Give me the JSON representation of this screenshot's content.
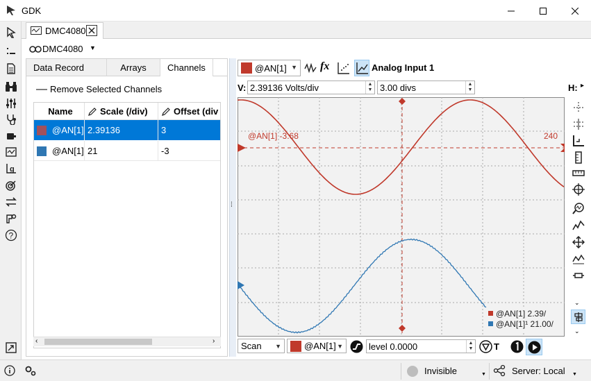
{
  "app": {
    "title": "GDK",
    "doc_tab": "DMC4080",
    "controller": "DMC4080"
  },
  "left_panel": {
    "tabs": [
      "Data Record",
      "Arrays",
      "Channels"
    ],
    "active_tab": "Channels",
    "remove_label": "Remove Selected Channels",
    "table": {
      "headers": [
        "Name",
        "Scale (/div)",
        "Offset (div"
      ],
      "rows": [
        {
          "name": "@AN[1]",
          "scale": "2.39136",
          "offset": "3",
          "color": "#a0515c",
          "selected": true
        },
        {
          "name": "@AN[1]",
          "scale": "21",
          "offset": "-3",
          "color": "#2f77b3",
          "selected": false
        }
      ]
    }
  },
  "scope": {
    "channel_select": "@AN[1]",
    "channel_title": "Analog Input 1",
    "v_label": "V:",
    "v_scale": "2.39136 Volts/div",
    "v_divs": "3.00 divs",
    "h_label": "H:",
    "marker_label": "@AN[1] -3.68",
    "marker_value": "240",
    "legend": [
      {
        "text": "@AN[1] 2.39/",
        "color": "#c0392b"
      },
      {
        "text": "@AN[1]¹ 21.00/",
        "color": "#2f77b3"
      }
    ],
    "trace_colors": {
      "red": "#c0392b",
      "blue": "#2f77b3",
      "grid": "#a8a8a8",
      "bg": "#f2f2f2"
    },
    "trigger_mode": "Scan",
    "trigger_channel": "@AN[1]",
    "trigger_level": "level 0.0000",
    "trigger_t": "T"
  },
  "status": {
    "visibility": "Invisible",
    "server": "Server: Local"
  },
  "icons": [
    "pointer-icon",
    "binoculars-icon",
    "sliders-icon",
    "stethoscope-icon",
    "scope-icon",
    "target-icon",
    "help-icon",
    "gear-icon",
    "info-icon"
  ]
}
